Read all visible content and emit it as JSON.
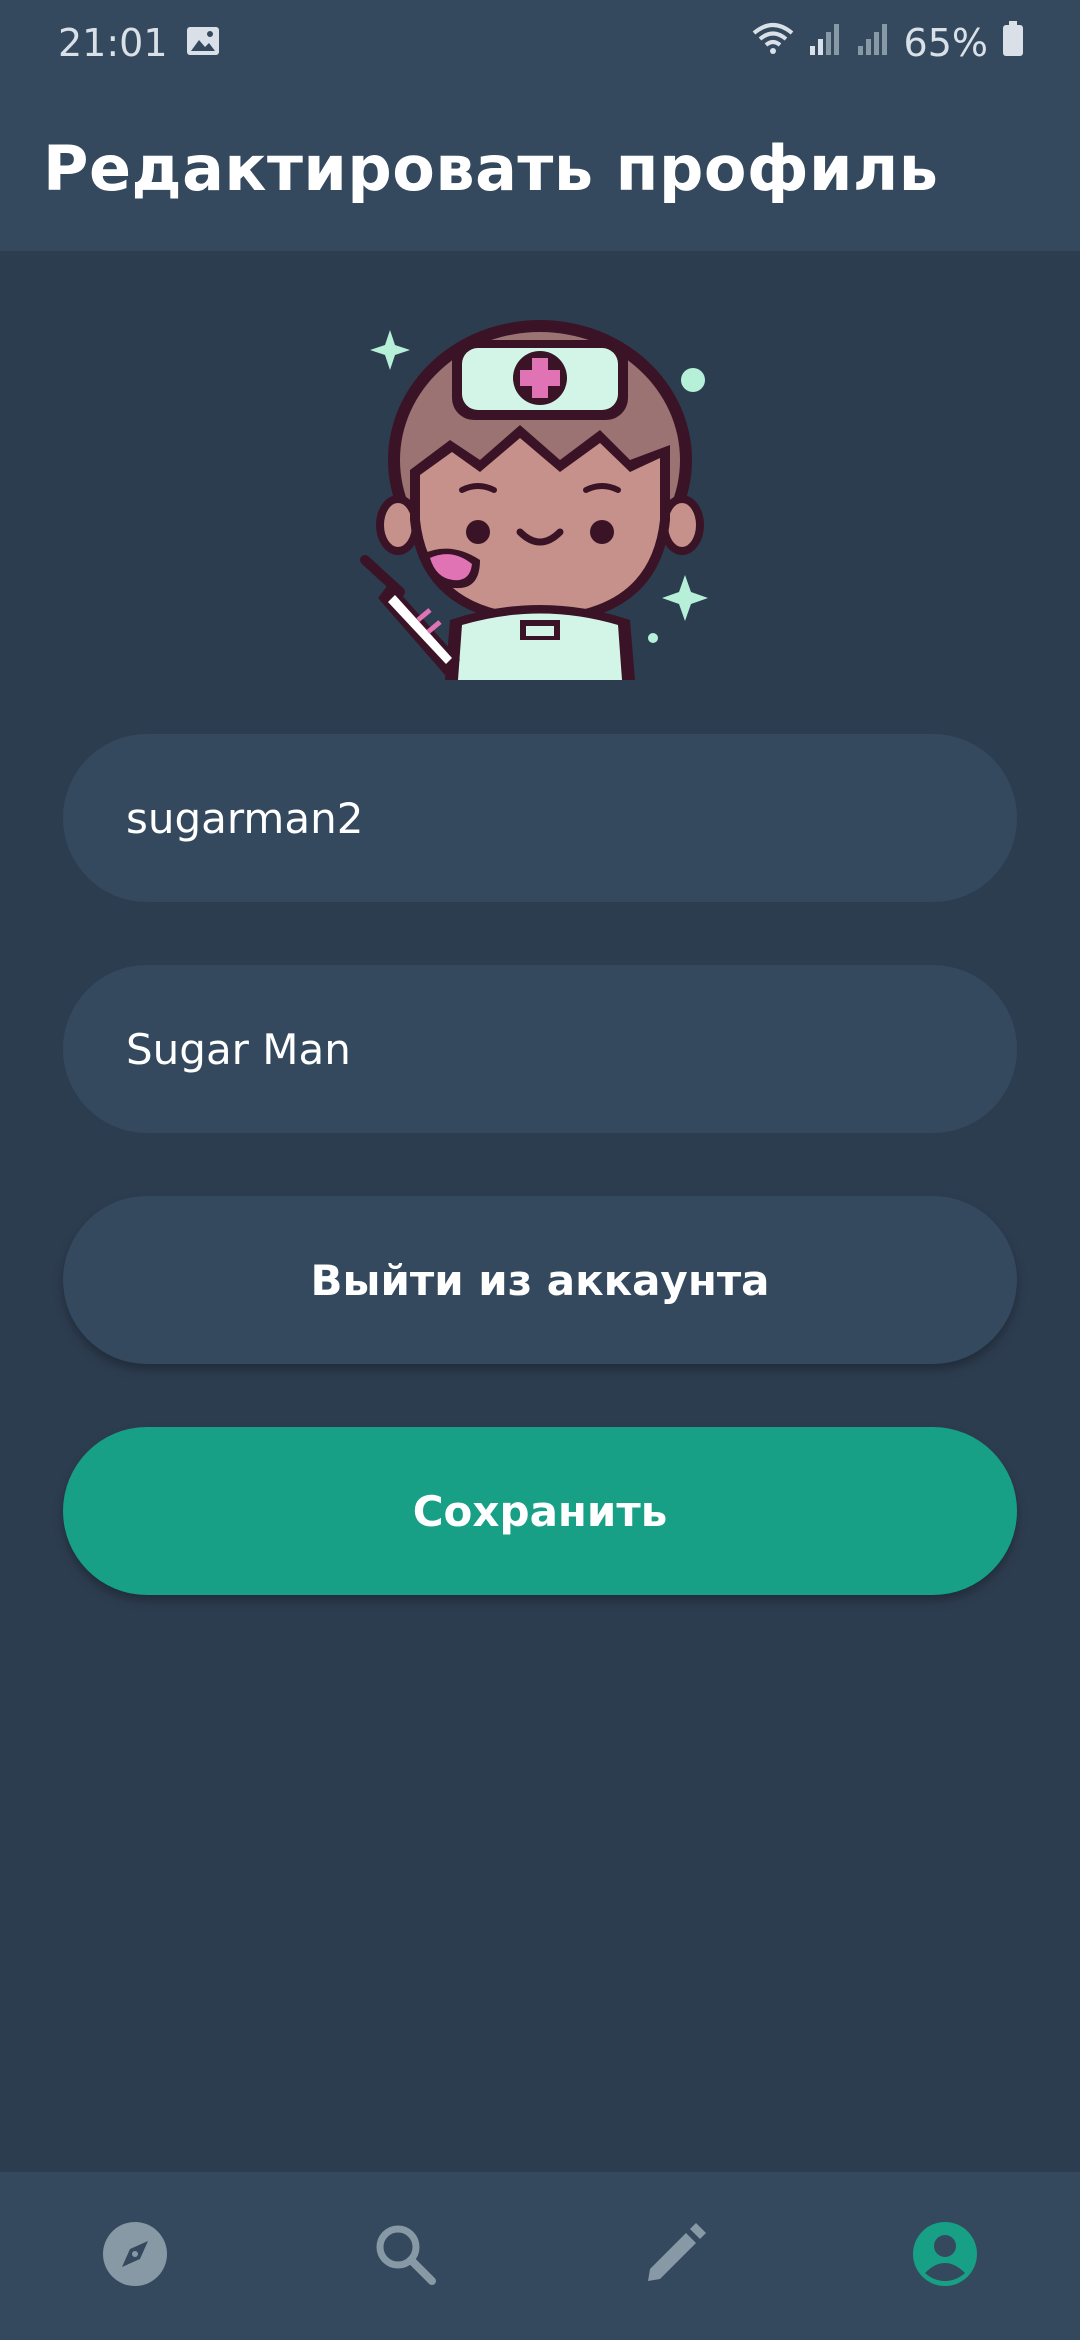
{
  "status_bar": {
    "time": "21:01",
    "battery_percent": "65%",
    "icons": [
      "gallery-icon",
      "wifi-icon",
      "signal-icon",
      "signal-icon",
      "battery-icon"
    ]
  },
  "app_bar": {
    "title": "Редактировать профиль"
  },
  "profile": {
    "avatar": "nurse-avatar",
    "username_value": "sugarman2",
    "name_value": "Sugar Man"
  },
  "actions": {
    "logout_label": "Выйти из аккаунта",
    "save_label": "Сохранить"
  },
  "bottom_nav": {
    "items": [
      "compass-icon",
      "search-icon",
      "pencil-icon",
      "account-icon"
    ],
    "active": "account-icon"
  },
  "colors": {
    "background": "#2d3d50",
    "surface": "#34495e",
    "accent": "#17a085",
    "nav_inactive": "#8899a6"
  }
}
